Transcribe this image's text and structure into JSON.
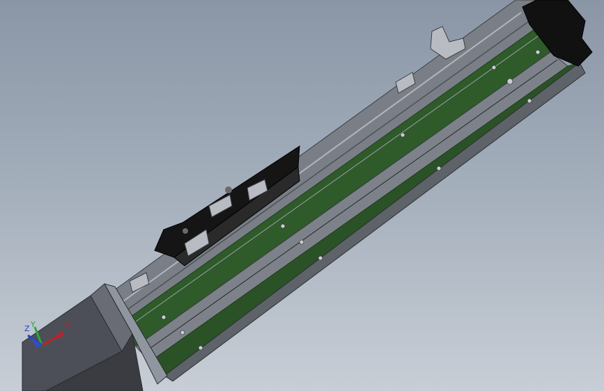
{
  "viewport": {
    "background_top": "#8a96a6",
    "background_bottom": "#c8ced6"
  },
  "model": {
    "name": "linear-module-assembly",
    "colors": {
      "profile_green": "#2f5a2a",
      "profile_green_dark": "#1f3f1c",
      "rail_gray": "#6a6e76",
      "rail_light": "#9aa0a8",
      "motor_gray": "#4c4f57",
      "motor_dark": "#3a3c42",
      "carriage_black": "#151515",
      "end_cap_black": "#111111"
    }
  },
  "triad": {
    "x_label": "X",
    "y_label": "Y",
    "z_label": "Z",
    "x_color": "#c0202a",
    "y_color": "#2aa838",
    "z_color": "#2040c8"
  }
}
